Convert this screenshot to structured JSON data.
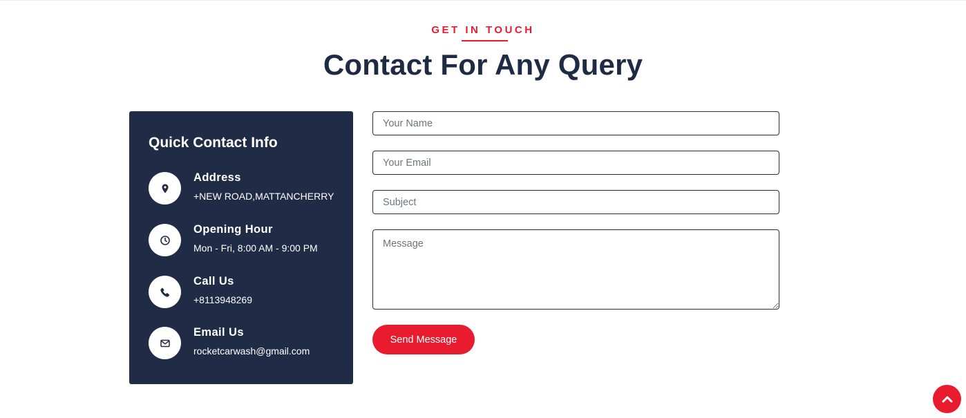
{
  "section": {
    "eyebrow": "GET IN TOUCH",
    "title": "Contact For Any Query"
  },
  "info": {
    "title": "Quick Contact Info",
    "items": [
      {
        "icon": "map-pin-icon",
        "label": "Address",
        "value": "+NEW ROAD,MATTANCHERRY"
      },
      {
        "icon": "clock-icon",
        "label": "Opening Hour",
        "value": "Mon - Fri, 8:00 AM - 9:00 PM"
      },
      {
        "icon": "phone-icon",
        "label": "Call Us",
        "value": "+8113948269"
      },
      {
        "icon": "envelope-icon",
        "label": "Email Us",
        "value": "rocketcarwash@gmail.com"
      }
    ]
  },
  "form": {
    "name_placeholder": "Your Name",
    "name_value": "",
    "email_placeholder": "Your Email",
    "email_value": "",
    "subject_placeholder": "Subject",
    "subject_value": "",
    "message_placeholder": "Message",
    "message_value": "",
    "submit_label": "Send Message"
  },
  "back_to_top_icon": "chevron-up-icon",
  "colors": {
    "accent": "#e81c2e",
    "navy": "#202b45",
    "heading": "#1f2a44"
  }
}
